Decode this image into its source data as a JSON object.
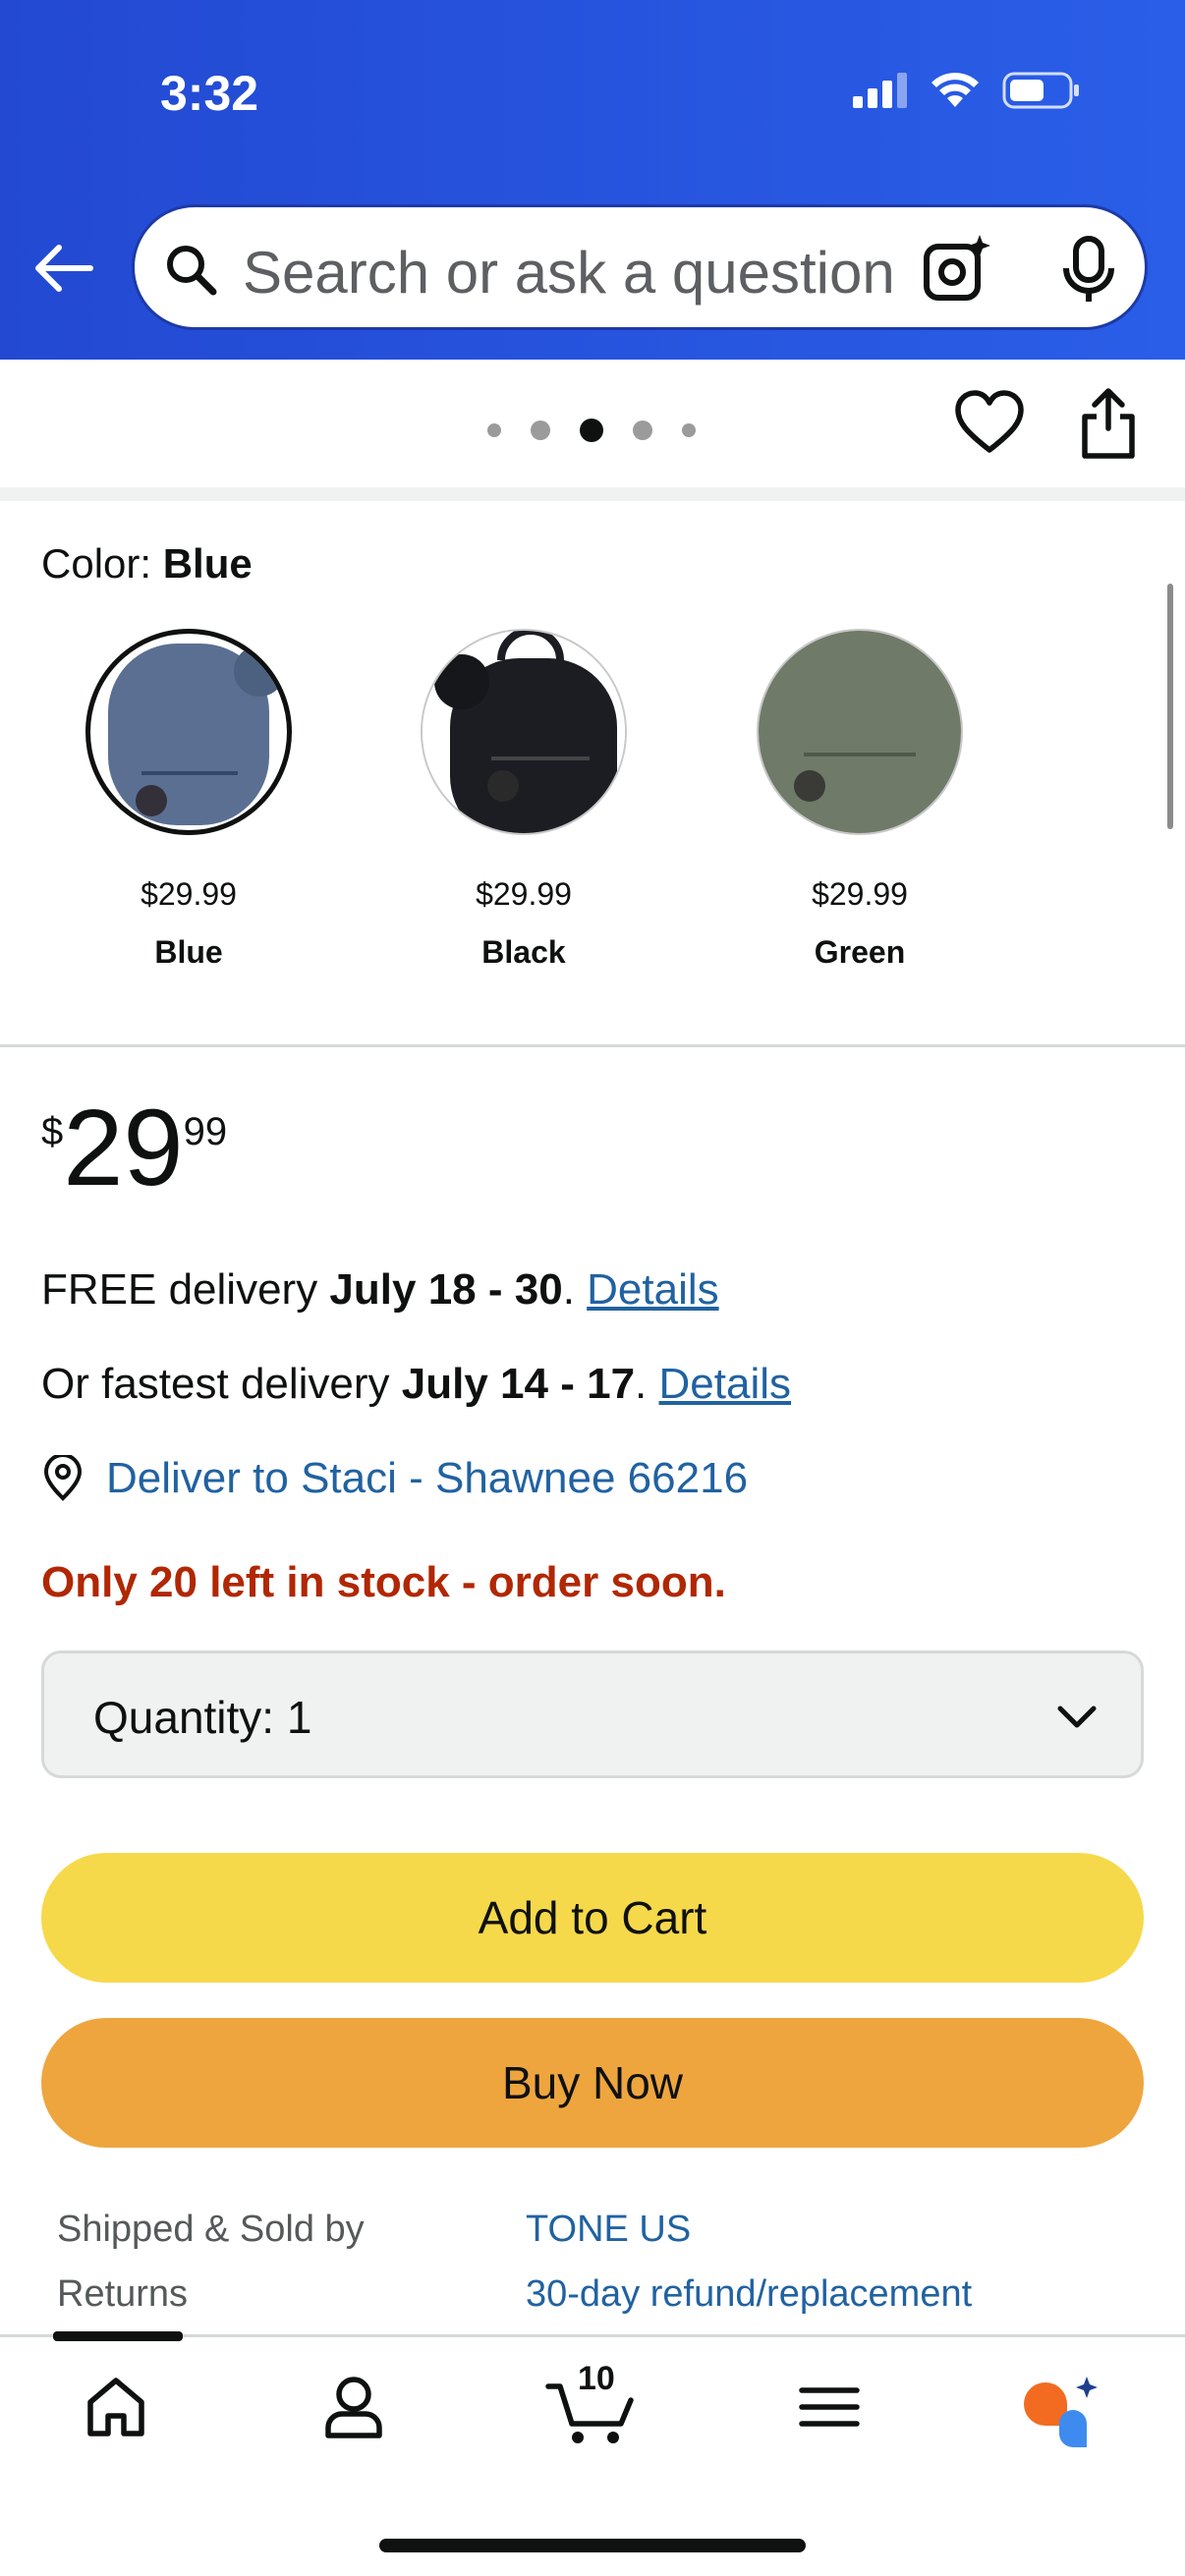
{
  "status_bar": {
    "time": "3:32"
  },
  "search": {
    "placeholder": "Search or ask a question"
  },
  "carousel": {
    "dot_count": 5,
    "active_index": 2
  },
  "color": {
    "label": "Color:",
    "selected": "Blue",
    "options": [
      {
        "price": "$29.99",
        "name": "Blue",
        "swatch": "#5a6f92"
      },
      {
        "price": "$29.99",
        "name": "Black",
        "swatch": "#1b1d22"
      },
      {
        "price": "$29.99",
        "name": "Green",
        "swatch": "#6f7a68"
      }
    ]
  },
  "price": {
    "symbol": "$",
    "whole": "29",
    "fraction": "99"
  },
  "delivery": {
    "free_prefix": "FREE delivery ",
    "free_dates": "July 18 - 30",
    "free_sep": ". ",
    "free_link": "Details",
    "fast_prefix": "Or fastest delivery ",
    "fast_dates": "July 14 - 17",
    "fast_sep": ". ",
    "fast_link": "Details",
    "deliver_to": "Deliver to Staci - Shawnee 66216"
  },
  "stock": "Only 20 left in stock - order soon.",
  "quantity": {
    "label": "Quantity:",
    "value": "1"
  },
  "buttons": {
    "add_to_cart": "Add to Cart",
    "buy_now": "Buy Now"
  },
  "info": {
    "shipped_label": "Shipped & Sold by",
    "shipped_value": "TONE US",
    "returns_label": "Returns",
    "returns_value": "30-day refund/replacement"
  },
  "nav": {
    "cart_count": "10"
  },
  "colors": {
    "header": "#2a5ee8",
    "add_to_cart": "#f6d94a",
    "buy_now": "#efa53e",
    "stock": "#b12704",
    "link": "#2162a1"
  }
}
